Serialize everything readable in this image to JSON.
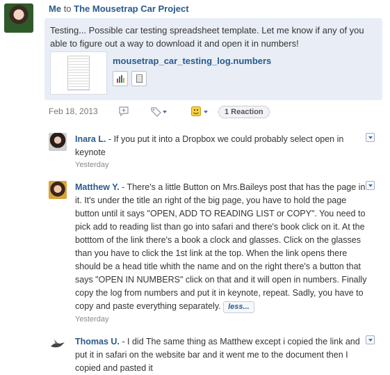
{
  "post": {
    "author": "Me",
    "to_word": "to",
    "group": "The Mousetrap Car Project",
    "text": "Testing... Possible car testing spreadsheet template. Let me know if any of you able to figure out a way to download it and open it in numbers!",
    "attachment": {
      "filename": "mousetrap_car_testing_log.numbers",
      "actions": [
        "numbers-app-icon",
        "document-icon"
      ]
    },
    "date": "Feb 18, 2013",
    "reactions_label": "1 Reaction"
  },
  "comments": [
    {
      "author": "Inara L.",
      "text": " - If you put it into a Dropbox we could probably select open in keynote",
      "time": "Yesterday"
    },
    {
      "author": "Matthew Y.",
      "text": " - There's a little Button on Mrs.Baileys post that has the page in it. It's under the title an right of the big page, you have to hold the page button until it says \"OPEN, ADD TO READING LIST or COPY\". You need to pick add to reading list than go into safari and there's book click on it. At the botttom of the link there's a book a clock and glasses. Click on the glasses than you have to click the 1st link at the top. When the link opens there should be a head title whith the name and on the right there's a button that says \"OPEN IN NUMBERS\" click on that and it will open in numbers. Finally copy the log from numbers and put it in keynote, repeat. Sadly, you have to copy and paste everything separately. ",
      "less_label": "less...",
      "time": "Yesterday"
    },
    {
      "author": "Thomas U.",
      "text": " - I did The same thing as Matthew except i copied the link and put it in safari on the website bar and it went me to the document then I copied and pasted it"
    }
  ],
  "icons": {
    "reply": "speech-bubble-plus-icon",
    "tag": "tag-icon",
    "reaction": "smiley-icon",
    "menu": "chevron-down-icon"
  },
  "colors": {
    "link": "#2a5a8c",
    "post_bg": "#e9eef6",
    "reaction_icon": "#e2a400"
  }
}
